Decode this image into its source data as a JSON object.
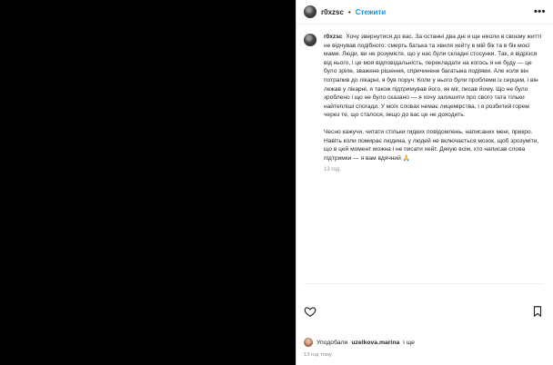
{
  "header": {
    "username": "r0xzsc",
    "separator": "•",
    "follow_label": "Стежити",
    "more_label": "•••"
  },
  "caption": {
    "username": "r0xzsc",
    "paragraph1": "Хочу звернутися до вас. За останні два дні я ще ніколи в своєму житті не відчував подібного: смерть батька та хвиля хейту в мій бік та в бік моєї мами. Люди, ви не розумієте, що у нас були складні стосунки. Так, я відрізся від нього, і це моя відповідальність, перекладати на когось я не буду — це було зріле, зважене рішення, спричинене багатьма подіями. Але коли він потрапив до лікарні, я був поруч. Коли у нього були проблеми із серцем, і він лежав у лікарні, я також підтримував його, як міг, писав йому. Що не було зроблено і що не було сказано — я хочу залишити про свого тата тільки найтепліші спогади. У моїх словах немає лицемірства, і я розбитий горем через те, що сталося, якщо до вас це не доходить.",
    "paragraph2": "Чесно кажучи, читати стільки гидких повідомлень, написаних мені, прикро. Навіть коли помирає людина, у людей не включається мозок, щоб зрозуміти, що в цей момент можна і не писати хейт. Дякую всім, хто написав слова підтримки — я вам вдячний 🙏",
    "time": "13 год."
  },
  "likes": {
    "prefix": "Уподобали",
    "user": "uzelkova.marina",
    "suffix": "і ще"
  },
  "footer": {
    "time_ago": "13 год тому"
  }
}
